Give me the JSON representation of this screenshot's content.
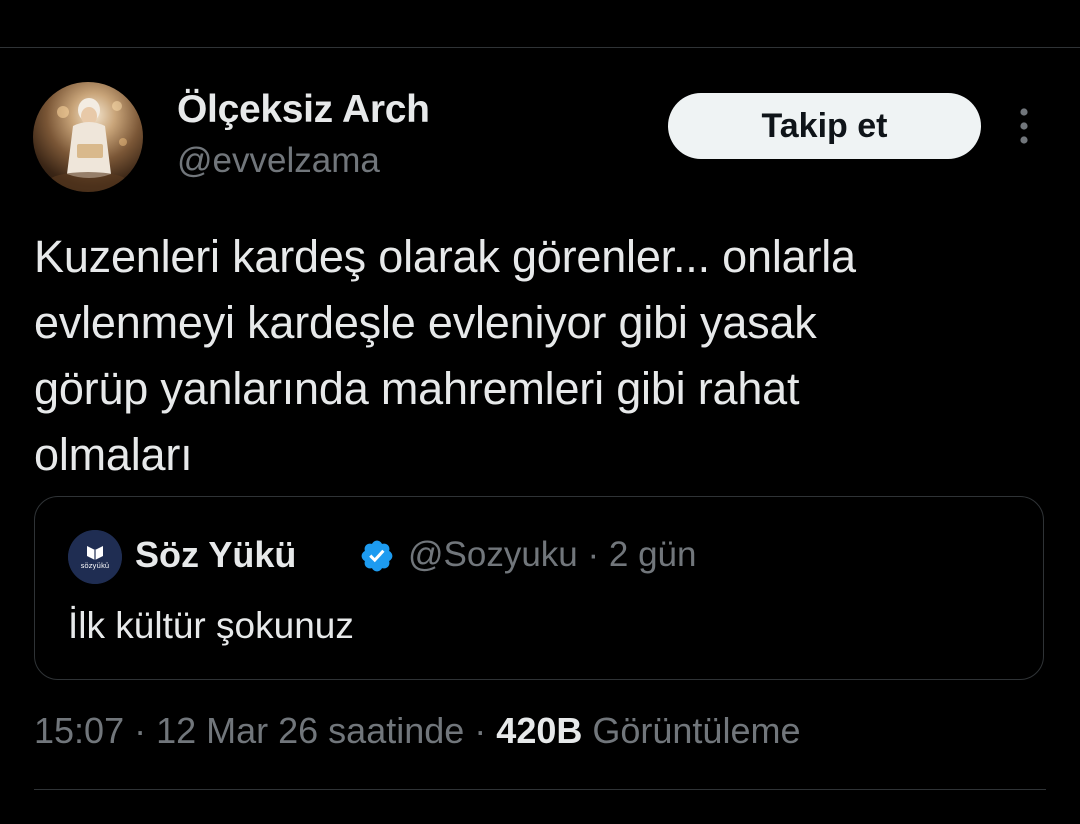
{
  "author": {
    "name": "Ölçeksiz Arch",
    "handle": "@evvelzama",
    "avatar_icon": "avatar-photo"
  },
  "actions": {
    "follow_label": "Takip et",
    "more_icon": "more-vertical-icon"
  },
  "tweet": {
    "text": "Kuzenleri kardeş olarak görenler... onlarla\nevlenmeyi kardeşle evleniyor gibi yasak\ngörüp yanlarında mahremleri gibi rahat\nolmaları"
  },
  "quote": {
    "author_name": "Söz Yükü",
    "verified_icon": "verified-badge-icon",
    "handle": "@Sozyuku",
    "separator": " · ",
    "time_ago": "2 gün",
    "text": "İlk kültür şokunuz",
    "avatar_text": "sözyükü"
  },
  "meta": {
    "time": "15:07",
    "separator": " · ",
    "date": "12 Mar 26 saatinde",
    "views_count": "420B",
    "views_label": "Görüntüleme"
  },
  "colors": {
    "background": "#000000",
    "text_primary": "#e7e9ea",
    "text_secondary": "#71767b",
    "divider": "#2f3336",
    "verified": "#1d9bf0",
    "follow_bg": "#eff3f4"
  }
}
